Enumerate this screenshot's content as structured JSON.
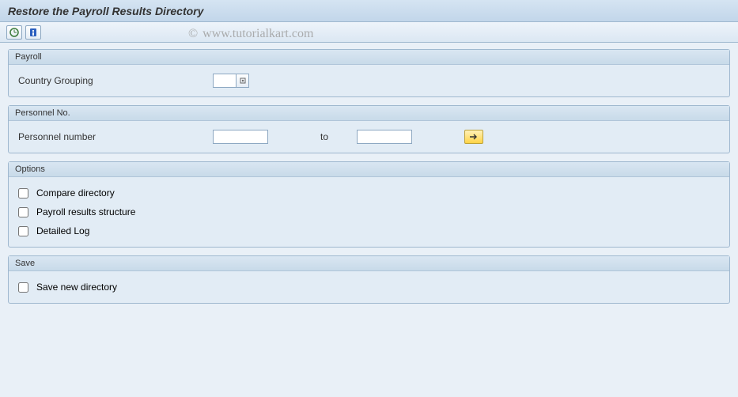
{
  "title": "Restore the Payroll Results Directory",
  "watermark": "www.tutorialkart.com",
  "groups": {
    "payroll": {
      "legend": "Payroll",
      "country_grouping_label": "Country Grouping",
      "country_grouping_value": ""
    },
    "personnel": {
      "legend": "Personnel No.",
      "number_label": "Personnel number",
      "to_label": "to",
      "from_value": "",
      "to_value": ""
    },
    "options": {
      "legend": "Options",
      "items": [
        {
          "label": "Compare directory",
          "checked": false
        },
        {
          "label": "Payroll results structure",
          "checked": false
        },
        {
          "label": "Detailed Log",
          "checked": false
        }
      ]
    },
    "save": {
      "legend": "Save",
      "items": [
        {
          "label": "Save new directory",
          "checked": false
        }
      ]
    }
  }
}
